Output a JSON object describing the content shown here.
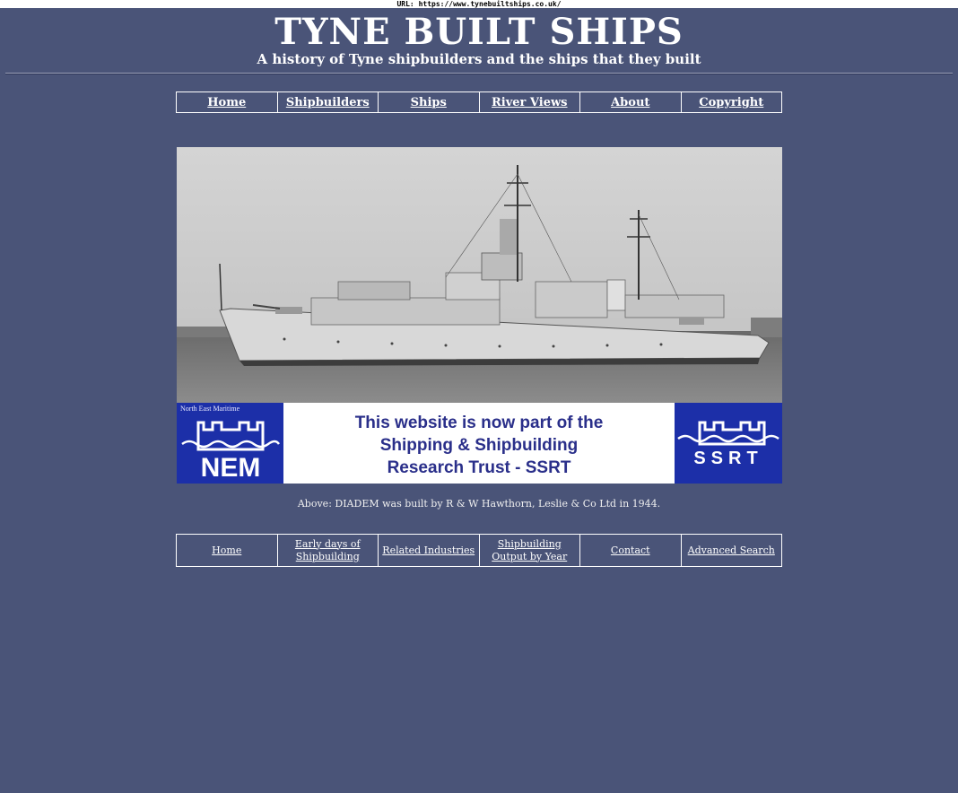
{
  "browser": {
    "url_label": "URL: https://www.tynebuiltships.co.uk/"
  },
  "header": {
    "title": "TYNE BUILT SHIPS",
    "subtitle": "A history of Tyne shipbuilders and the ships that they built"
  },
  "top_nav": [
    {
      "label": "Home"
    },
    {
      "label": "Shipbuilders"
    },
    {
      "label": "Ships"
    },
    {
      "label": "River Views"
    },
    {
      "label": "About"
    },
    {
      "label": "Copyright"
    }
  ],
  "banner": {
    "nem_label": "North East Maritime",
    "nem_letters": "NEM",
    "ssrt_letters": "SSRT",
    "text_lines": [
      "This website is now part of the",
      "Shipping & Shipbuilding",
      "Research Trust - SSRT"
    ]
  },
  "caption": "Above: DIADEM was built by R & W Hawthorn, Leslie & Co Ltd in 1944.",
  "bottom_nav": [
    {
      "label": "Home"
    },
    {
      "label": "Early days of Shipbuilding"
    },
    {
      "label": "Related Industries"
    },
    {
      "label": "Shipbuilding Output by Year"
    },
    {
      "label": "Contact"
    },
    {
      "label": "Advanced Search"
    }
  ],
  "colors": {
    "page_background": "#4a5478",
    "banner_blue": "#1c2fa8",
    "banner_text": "#2a2f8a"
  }
}
